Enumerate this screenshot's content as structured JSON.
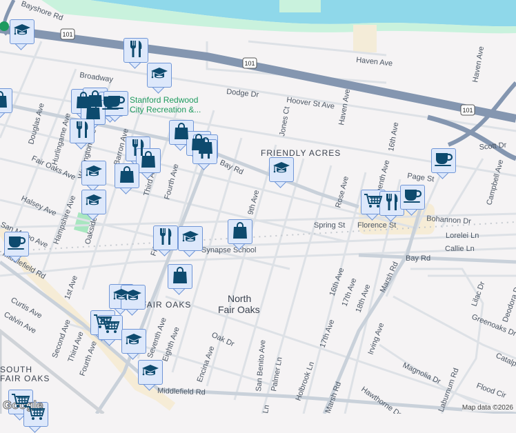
{
  "map": {
    "highway_shield": "101",
    "streets": [
      "Bayshore Rd",
      "Broadway",
      "Dodge Dr",
      "Hoover St Ave",
      "Haven Ave",
      "Haven Ave",
      "Jones Ct",
      "Haven Ave",
      "16th Ave",
      "Scott Dr",
      "Page St",
      "Campbell Ave",
      "Douglas Ave",
      "Hurlingame Ave",
      "Warrington Ave",
      "Barron Ave",
      "Third Ave",
      "Fourth Ave",
      "Fifth Ave",
      "Bay Rd",
      "9th Ave",
      "Rose Ave",
      "Fifteenth Ave",
      "Fair Oaks Ave",
      "Halsey Ave",
      "Hampshire Ave",
      "Oakside Ave",
      "San Mateo Ave",
      "Spring St",
      "Bohannon Dr",
      "Lorelei Ln",
      "Callie Ln",
      "Bay Rd",
      "Middlefield Rd",
      "1st Ave",
      "Curtis Ave",
      "Calvin Ave",
      "Second Ave",
      "Third Ave",
      "Fourth Ave",
      "Seventh Ave",
      "Eighth Ave",
      "Oak Dr",
      "Encina Ave",
      "San Benito Ave",
      "Palmer Ln",
      "Holbrook Ln",
      "17th Ave",
      "16th Ave",
      "17th Ave",
      "18th Ave",
      "Marsh Rd",
      "Marsh Rd",
      "Irving Ave",
      "Lilac Dr",
      "Deodora Dr",
      "Greenoaks Dr",
      "Catalpa Dr",
      "Magnolia Dr",
      "Laburnum Rd",
      "Flood Cir",
      "Hawthorne Dr",
      "Middlefield Rd",
      "Ln",
      "Florence St"
    ],
    "neighborhoods": [
      "FRIENDLY ACRES",
      "FAIR OAKS",
      "SOUTH",
      "FAIR OAKS"
    ],
    "places": {
      "north_fair_oaks_1": "North",
      "north_fair_oaks_2": "Fair Oaks",
      "poi_1": "Stanford Redwood",
      "poi_2": "City Recreation &...",
      "school": "Synapse School"
    },
    "attribution": "Map data ©2026",
    "logo": "Google",
    "colors": {
      "marker_fill": "#dde8fb",
      "marker_border": "#6f95d6",
      "icon": "#0d4a6e",
      "water": "#8fd8ea",
      "park": "#c9f2dd",
      "highway": "#8496b0"
    }
  },
  "markers": [
    "school",
    "restaurant",
    "school",
    "shopping",
    "shopping",
    "cafe",
    "cafe",
    "shopping",
    "restaurant",
    "shopping",
    "shopping",
    "shopping",
    "restaurant",
    "restaurant",
    "shopping",
    "shopping",
    "school",
    "school",
    "school",
    "cafe",
    "grocery",
    "restaurant",
    "cafe",
    "shopping",
    "cafe",
    "restaurant",
    "school",
    "shopping",
    "school",
    "school",
    "grocery",
    "grocery",
    "school",
    "school",
    "grocery",
    "grocery",
    "shopping"
  ]
}
